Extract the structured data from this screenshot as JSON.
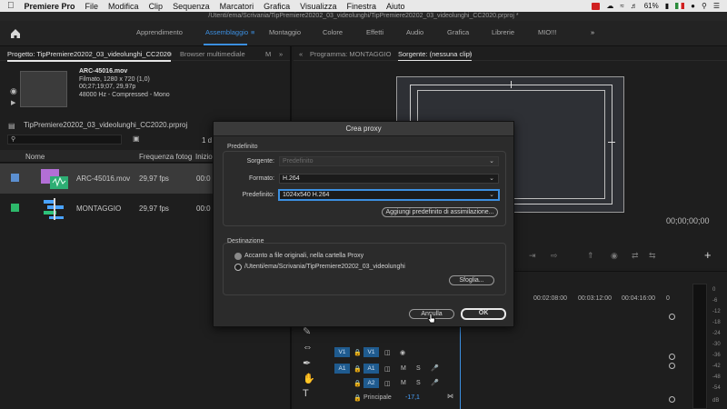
{
  "menubar": {
    "app": "Premiere Pro",
    "items": [
      "File",
      "Modifica",
      "Clip",
      "Sequenza",
      "Marcatori",
      "Grafica",
      "Visualizza",
      "Finestra",
      "Aiuto"
    ],
    "battery": "61%"
  },
  "window": {
    "title": "/Utenti/ema/Scrivania/TipPremiere20202_03_videolunghi/TipPremiere20202_03_videolunghi_CC2020.prproj *"
  },
  "workspaces": {
    "items": [
      "Apprendimento",
      "Assemblaggio",
      "Montaggio",
      "Colore",
      "Effetti",
      "Audio",
      "Grafica",
      "Librerie",
      "MIO!!!"
    ],
    "active": "Assemblaggio"
  },
  "project": {
    "tabs": [
      "Progetto: TipPremiere20202_03_videolunghi_CC2020",
      "Browser multimediale",
      "M"
    ],
    "clip_info": {
      "name": "ARC-45016.mov",
      "line1": "Filmato, 1280 x 720 (1,0)",
      "line2": "00;27;19;07, 29,97p",
      "line3": "48000 Hz - Compressed - Mono"
    },
    "file": "TipPremiere20202_03_videolunghi_CC2020.prproj",
    "count_label": "1 d",
    "columns": [
      "Nome",
      "Frequenza fotog",
      "Inizio"
    ],
    "rows": [
      {
        "name": "ARC-45016.mov",
        "fps": "29,97 fps",
        "start": "00:0",
        "color": "#5b8fd0"
      },
      {
        "name": "MONTAGGIO",
        "fps": "29,97 fps",
        "start": "00:0",
        "color": "#2db86a"
      }
    ]
  },
  "monitors": {
    "tabs": [
      "Programma: MONTAGGIO",
      "Sorgente: (nessuna clip)"
    ],
    "timecode": "00;00;00;00"
  },
  "timeline": {
    "ruler": [
      "00:02:08:00",
      "00:03:12:00",
      "00:04:16:00",
      "0"
    ],
    "tracks": [
      {
        "label": "V1",
        "target": "V1"
      },
      {
        "label": "A1",
        "target": "A1"
      },
      {
        "label": "",
        "target": "A2"
      }
    ],
    "mix_label": "Principale",
    "mix_value": "-17,1",
    "meter_scale": [
      "0",
      "-6",
      "-12",
      "-18",
      "-24",
      "-30",
      "-36",
      "-42",
      "-48",
      "-54",
      "dB"
    ]
  },
  "dialog": {
    "title": "Crea proxy",
    "section_preset": "Predefinito",
    "source_label": "Sorgente:",
    "source_value": "Predefinito",
    "format_label": "Formato:",
    "format_value": "H.264",
    "preset_label": "Predefinito:",
    "preset_value": "1024x540 H.264",
    "add_preset_button": "Aggiungi predefinito di assimilazione...",
    "section_dest": "Destinazione",
    "radio1": "Accanto a file originali, nella cartella Proxy",
    "radio2": "/Utenti/ema/Scrivania/TipPremiere20202_03_videolunghi",
    "browse_button": "Sfoglia...",
    "cancel_button": "Annulla",
    "ok_button": "OK"
  }
}
